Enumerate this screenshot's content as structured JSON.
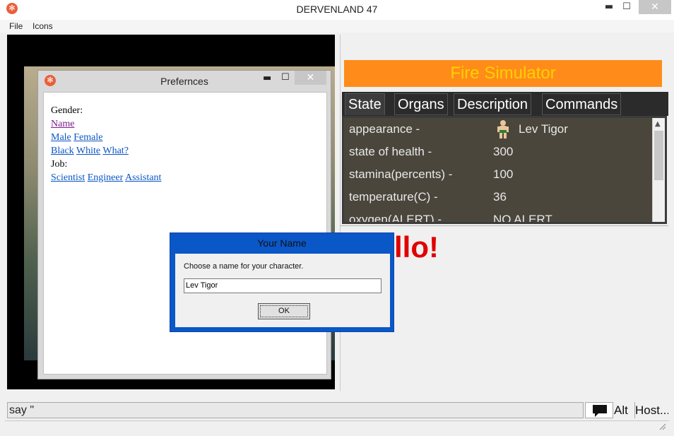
{
  "window": {
    "title": "DERVENLAND 47",
    "icon": "snowflake-app-icon",
    "min_glyph": "▬",
    "max_glyph": "☐",
    "close_glyph": "✕"
  },
  "menu": {
    "items": [
      "File",
      "Icons"
    ]
  },
  "preferences": {
    "title": "Prefernces",
    "lines": {
      "gender_label": "Gender:",
      "name_link": "Name",
      "male": "Male",
      "female": "Female",
      "black": "Black",
      "white": "White",
      "what": "What?",
      "job_label": "Job:",
      "scientist": "Scientist",
      "engineer": "Engineer",
      "assistant": "Assistant"
    }
  },
  "right_panel": {
    "banner": "Fire Simulator",
    "banner_color": "#ff8c1a",
    "banner_text_color": "#ffd000",
    "tabs": [
      "State",
      "Organs",
      "Description",
      "Commands"
    ],
    "active_tab": "State",
    "state_rows": [
      {
        "label": "appearance -",
        "value": "Lev Tigor",
        "icon": "person-icon"
      },
      {
        "label": "state of health -",
        "value": "300"
      },
      {
        "label": "stamina(percents) -",
        "value": "100"
      },
      {
        "label": "temperature(C) -",
        "value": "36"
      },
      {
        "label": "oxygen(ALERT) -",
        "value": "NO ALERT"
      }
    ],
    "hello_text": "llo!",
    "hello_color": "#e00000"
  },
  "dialog": {
    "title": "Your Name",
    "prompt": "Choose a name for your character.",
    "input_value": "Lev Tigor",
    "ok_label": "OK"
  },
  "bottom": {
    "command_value": "say \"",
    "chat_icon": "speech-bubble-icon",
    "alt_label": "Alt",
    "host_label": "Host..."
  }
}
